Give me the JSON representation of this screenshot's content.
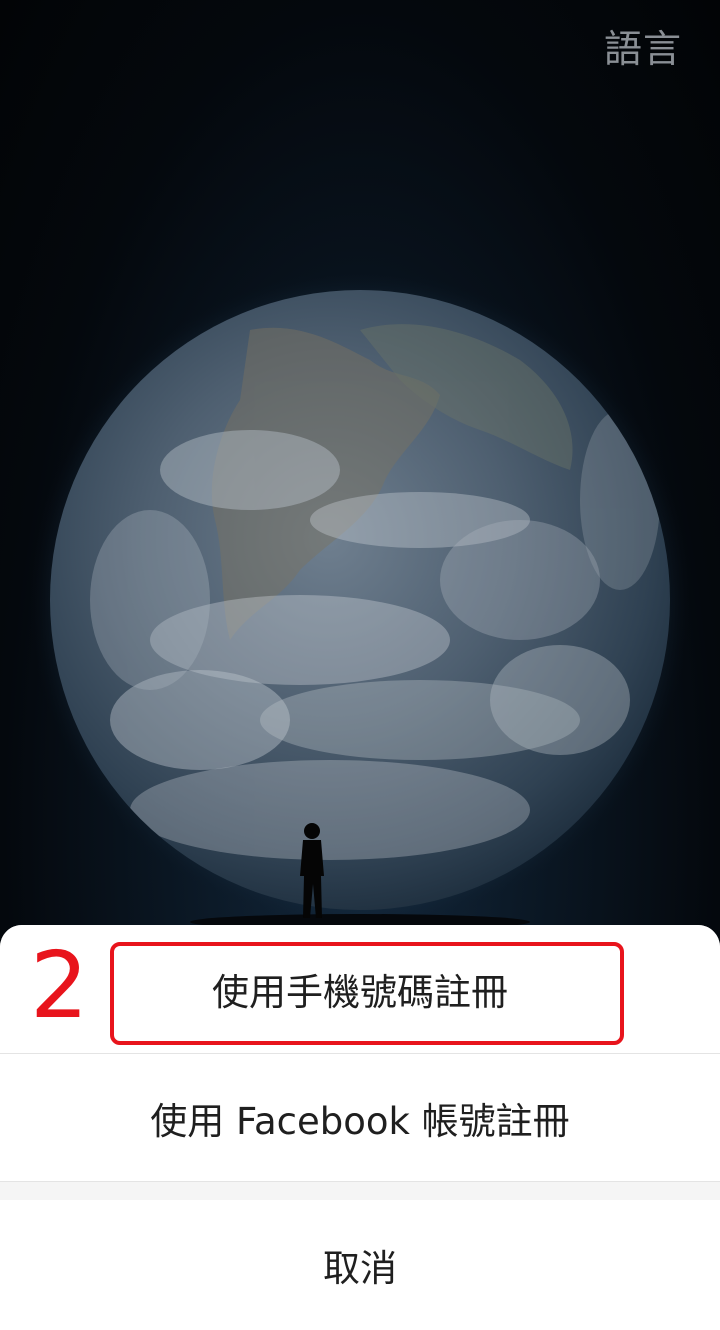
{
  "header": {
    "language_label": "語言"
  },
  "sheet": {
    "options": [
      {
        "label": "使用手機號碼註冊"
      },
      {
        "label": "使用 Facebook 帳號註冊"
      }
    ],
    "cancel_label": "取消"
  },
  "annotation": {
    "step_number": "2"
  },
  "colors": {
    "highlight": "#e8141c",
    "sheet_background": "#ffffff",
    "language_text": "#8a8f95"
  },
  "icons": {
    "background": "earth-illustration",
    "figure": "standing-person-silhouette"
  }
}
